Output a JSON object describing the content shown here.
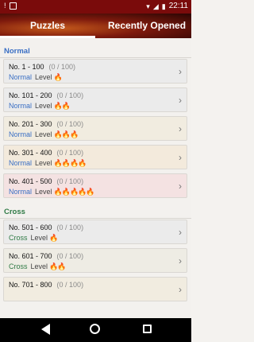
{
  "status": {
    "time": "22:11",
    "battery_text": ""
  },
  "tabs": [
    {
      "label": "Puzzles",
      "selected": true
    },
    {
      "label": "Recently Opened",
      "selected": false
    }
  ],
  "sections": [
    {
      "title": "Normal",
      "color": "#3a6fc4",
      "items": [
        {
          "name": "No. 1 - 100",
          "progress": "(0 / 100)",
          "category": "Normal",
          "level_label": "Level",
          "flames": "🔥",
          "bg": "#ebebeb"
        },
        {
          "name": "No. 101 - 200",
          "progress": "(0 / 100)",
          "category": "Normal",
          "level_label": "Level",
          "flames": "🔥🔥",
          "bg": "#ebebeb"
        },
        {
          "name": "No. 201 - 300",
          "progress": "(0 / 100)",
          "category": "Normal",
          "level_label": "Level",
          "flames": "🔥🔥🔥",
          "bg": "#f1ece0"
        },
        {
          "name": "No. 301 - 400",
          "progress": "(0 / 100)",
          "category": "Normal",
          "level_label": "Level",
          "flames": "🔥🔥🔥🔥",
          "bg": "#f3eadc"
        },
        {
          "name": "No. 401 - 500",
          "progress": "(0 / 100)",
          "category": "Normal",
          "level_label": "Level",
          "flames": "🔥🔥🔥🔥🔥",
          "bg": "#f4e2e2"
        }
      ]
    },
    {
      "title": "Cross",
      "color": "#2f7a45",
      "items": [
        {
          "name": "No. 501 - 600",
          "progress": "(0 / 100)",
          "category": "Cross",
          "level_label": "Level",
          "flames": "🔥",
          "bg": "#ebebeb"
        },
        {
          "name": "No. 601 - 700",
          "progress": "(0 / 100)",
          "category": "Cross",
          "level_label": "Level",
          "flames": "🔥🔥",
          "bg": "#eeece4"
        },
        {
          "name": "No. 701 - 800",
          "progress": "(0 / 100)",
          "category": "",
          "level_label": "",
          "flames": "",
          "bg": "#f1ece0"
        }
      ]
    }
  ]
}
